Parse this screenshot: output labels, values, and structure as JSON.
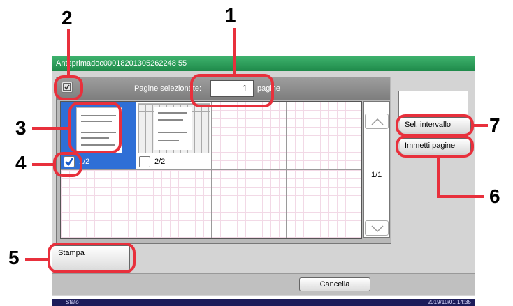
{
  "title_bar": {
    "text": "Anteprimadoc00018201305262248 55"
  },
  "selection": {
    "label": "Pagine selezionate:",
    "count": "1",
    "unit": "pagine"
  },
  "pages": [
    {
      "page_label": "1/2",
      "selected": true
    },
    {
      "page_label": "2/2",
      "selected": false
    }
  ],
  "pager": {
    "indicator": "1/1"
  },
  "buttons": {
    "select_range": "Sel. intervallo",
    "enter_pages": "Immetti pagine",
    "print": "Stampa",
    "cancel": "Cancella"
  },
  "status_bar": {
    "status": "Stato",
    "datetime": "2019/10/01  14:35"
  },
  "callouts": [
    "1",
    "2",
    "3",
    "4",
    "5",
    "6",
    "7"
  ],
  "colors": {
    "accent_green": "#1f8a4a",
    "selection_blue": "#2f6fd6",
    "callout_red": "#e8303c"
  }
}
